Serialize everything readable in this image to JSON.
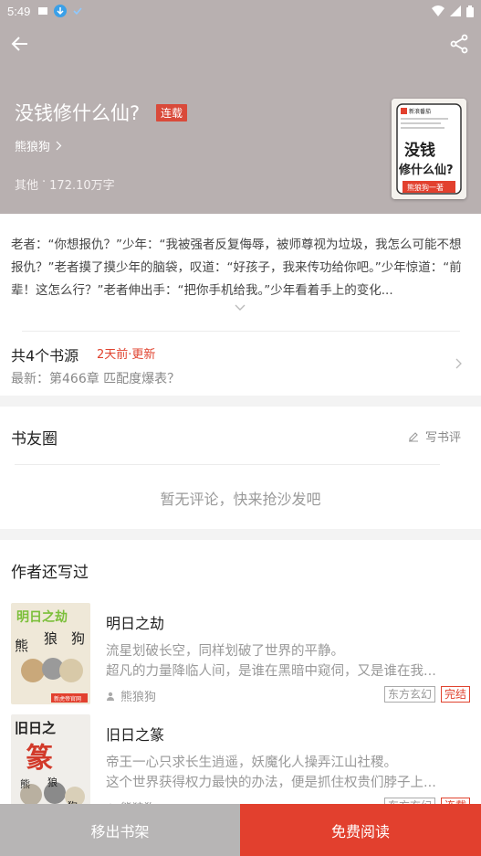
{
  "status_bar": {
    "time": "5:49"
  },
  "book": {
    "title": "没钱修什么仙?",
    "status_tag": "连载",
    "author": "熊狼狗",
    "category": "其他",
    "separator": "·",
    "word_count": "172.10万字",
    "cover": {
      "publisher": "新浪番茄",
      "line1": "没钱",
      "line2": "修什么仙?",
      "author_banner": "熊狼狗一著"
    },
    "intro": "老者：“你想报仇？”少年：“我被强者反复侮辱，被师尊视为垃圾，我怎么可能不想报仇？”老者摸了摸少年的脑袋，叹道：“好孩子，我来传功给你吧。”少年惊道：“前辈！这怎么行？”老者伸出手：“把你手机给我。”少年看着手上的变化..."
  },
  "sources": {
    "count_label": "共4个书源",
    "updated_label": "2天前·更新",
    "latest_label": "最新：第466章 匹配度爆表？"
  },
  "community": {
    "title": "书友圈",
    "write_review_label": "写书评",
    "empty_text": "暂无评论，快来抢沙发吧"
  },
  "other_books": {
    "title": "作者还写过",
    "items": [
      {
        "name": "明日之劫",
        "desc_line1": "流星划破长空，同样划破了世界的平静。",
        "desc_line2": "超凡的力量降临人间，是谁在黑暗中窥伺，又是谁在我...",
        "author": "熊狼狗",
        "genre": "东方玄幻",
        "status": "完结",
        "cover_title": "明日之劫",
        "cover_chars": [
          "熊",
          "狼",
          "狗"
        ],
        "cover_badge": "新虎帝官网"
      },
      {
        "name": "旧日之篆",
        "desc_line1": "帝王一心只求长生逍遥，妖魔化人操弄江山社稷。",
        "desc_line2": "这个世界获得权力最快的办法，便是抓住权贵们脖子上...",
        "author": "熊狼狗",
        "genre": "东方玄幻",
        "status": "连载",
        "cover_title": "旧日之",
        "cover_chars": [
          "篆",
          "熊",
          "狼",
          "狗"
        ]
      }
    ]
  },
  "bottom": {
    "remove_label": "移出书架",
    "read_label": "免费阅读"
  },
  "colors": {
    "accent": "#e2402e",
    "header_bg": "#b8b0b0",
    "muted": "#999999"
  }
}
